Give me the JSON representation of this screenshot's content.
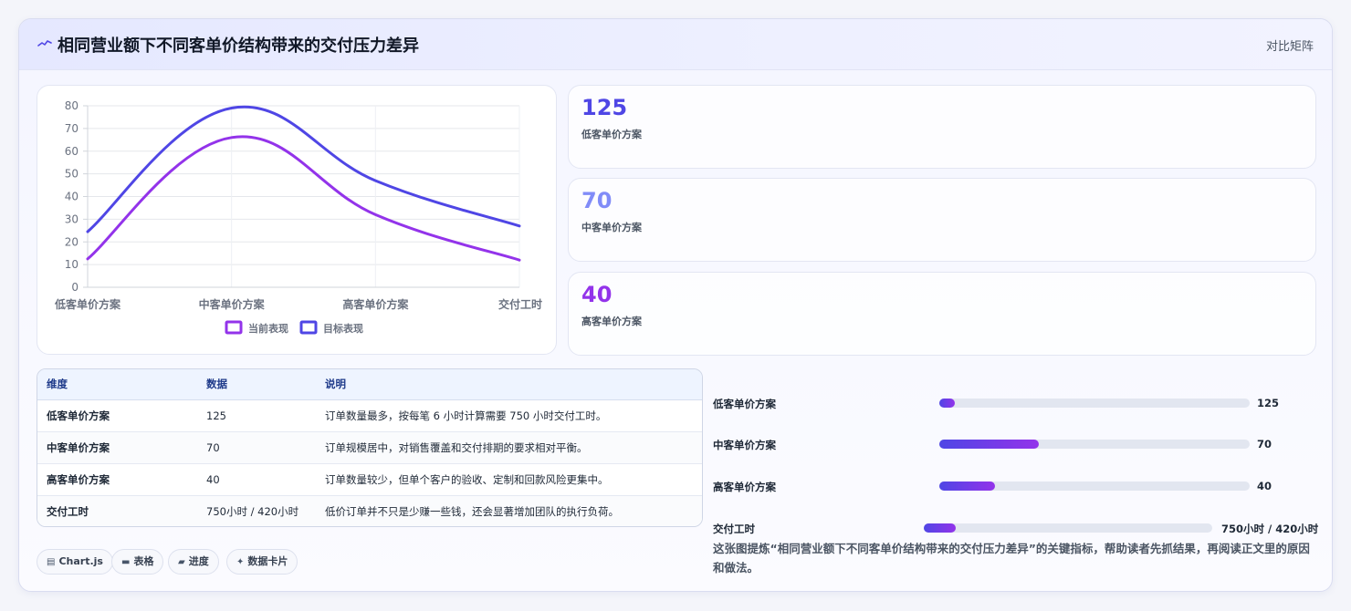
{
  "header": {
    "title": "相同营业额下不同客单价结构带来的交付压力差异",
    "right_label": "对比矩阵",
    "icon": "wave-icon"
  },
  "colors": {
    "current": "#9333ea",
    "target": "#4f46e5",
    "accent": "#4f46e5"
  },
  "chart_data": {
    "type": "line",
    "categories": [
      "低客单价方案",
      "中客单价方案",
      "高客单价方案",
      "交付工时"
    ],
    "series": [
      {
        "name": "当前表现",
        "values": [
          12.5,
          66,
          32,
          12
        ]
      },
      {
        "name": "目标表现",
        "values": [
          24.5,
          79,
          47,
          27
        ]
      }
    ],
    "ylim": [
      0,
      80
    ],
    "yticks": [
      0,
      10,
      20,
      30,
      40,
      50,
      60,
      70,
      80
    ],
    "grid": true,
    "legend": "bottom"
  },
  "stats": [
    {
      "value": "125",
      "label": "低客单价方案",
      "color": "#4f46e5"
    },
    {
      "value": "70",
      "label": "中客单价方案",
      "color": "#818cf8"
    },
    {
      "value": "40",
      "label": "高客单价方案",
      "color": "#9333ea"
    }
  ],
  "table": {
    "headers": [
      "维度",
      "数据",
      "说明"
    ],
    "rows": [
      [
        "低客单价方案",
        "125",
        "订单数量最多，按每笔 6 小时计算需要 750 小时交付工时。"
      ],
      [
        "中客单价方案",
        "70",
        "订单规模居中，对销售覆盖和交付排期的要求相对平衡。"
      ],
      [
        "高客单价方案",
        "40",
        "订单数量较少，但单个客户的验收、定制和回款风险更集中。"
      ],
      [
        "交付工时",
        "750小时 / 420小时",
        "低价订单并不只是少赚一些钱，还会显著增加团队的执行负荷。"
      ]
    ]
  },
  "progress": [
    {
      "label": "低客单价方案",
      "value": "125",
      "fraction": 0.05
    },
    {
      "label": "中客单价方案",
      "value": "70",
      "fraction": 0.32
    },
    {
      "label": "高客单价方案",
      "value": "40",
      "fraction": 0.18
    },
    {
      "label": "交付工时",
      "value": "750小时 / 420小时",
      "fraction": 0.11
    }
  ],
  "note": "这张图提炼“相同营业额下不同客单价结构带来的交付压力差异”的关键指标，帮助读者先抓结果，再阅读正文里的原因和做法。",
  "tags": [
    {
      "icon": "chart-icon",
      "label": "Chart.js"
    },
    {
      "icon": "table-icon",
      "label": "表格"
    },
    {
      "icon": "progress-icon",
      "label": "进度"
    },
    {
      "icon": "card-icon",
      "label": "数据卡片"
    }
  ]
}
